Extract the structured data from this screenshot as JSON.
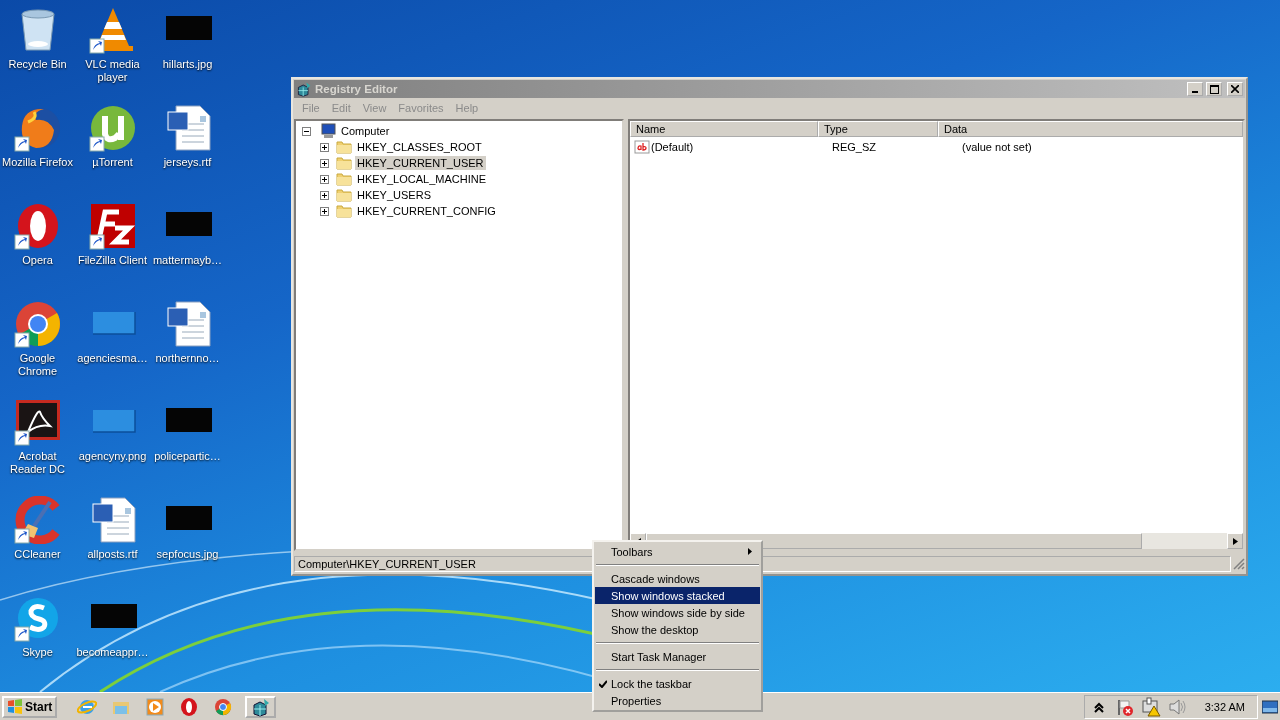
{
  "desktop": {
    "icons": [
      {
        "label": "Recycle Bin",
        "kind": "recycle",
        "shortcut": false
      },
      {
        "label": "Mozilla Firefox",
        "kind": "firefox",
        "shortcut": true
      },
      {
        "label": "Opera",
        "kind": "opera",
        "shortcut": true
      },
      {
        "label": "Google Chrome",
        "kind": "chrome",
        "shortcut": true
      },
      {
        "label": "Acrobat Reader DC",
        "kind": "acrobat",
        "shortcut": true
      },
      {
        "label": "CCleaner",
        "kind": "ccleaner",
        "shortcut": true
      },
      {
        "label": "Skype",
        "kind": "skype",
        "shortcut": true
      },
      {
        "label": "VLC media player",
        "kind": "vlc",
        "shortcut": true
      },
      {
        "label": "µTorrent",
        "kind": "utorrent",
        "shortcut": true
      },
      {
        "label": "FileZilla Client",
        "kind": "filezilla",
        "shortcut": true
      },
      {
        "label": "agenciesma…",
        "kind": "blank",
        "shortcut": false
      },
      {
        "label": "agencyny.png",
        "kind": "blank",
        "shortcut": false
      },
      {
        "label": "allposts.rtf",
        "kind": "document",
        "shortcut": false
      },
      {
        "label": "becomeappr…",
        "kind": "thumb",
        "shortcut": false
      },
      {
        "label": "hillarts.jpg",
        "kind": "thumb",
        "shortcut": false
      },
      {
        "label": "jerseys.rtf",
        "kind": "document",
        "shortcut": false
      },
      {
        "label": "mattermayb…",
        "kind": "thumb",
        "shortcut": false
      },
      {
        "label": "northernno…",
        "kind": "document",
        "shortcut": false
      },
      {
        "label": "policepartic…",
        "kind": "thumb",
        "shortcut": false
      },
      {
        "label": "sepfocus.jpg",
        "kind": "thumb",
        "shortcut": false
      }
    ]
  },
  "window": {
    "title": "Registry Editor",
    "menu": [
      "File",
      "Edit",
      "View",
      "Favorites",
      "Help"
    ],
    "tree": {
      "label": "Computer",
      "expanded": true,
      "children": [
        {
          "label": "HKEY_CLASSES_ROOT",
          "expanded": false,
          "selected": false
        },
        {
          "label": "HKEY_CURRENT_USER",
          "expanded": false,
          "selected": true
        },
        {
          "label": "HKEY_LOCAL_MACHINE",
          "expanded": false,
          "selected": false
        },
        {
          "label": "HKEY_USERS",
          "expanded": false,
          "selected": false
        },
        {
          "label": "HKEY_CURRENT_CONFIG",
          "expanded": false,
          "selected": false
        }
      ]
    },
    "values": {
      "columns": [
        "Name",
        "Type",
        "Data"
      ],
      "rows": [
        {
          "name": "(Default)",
          "type": "REG_SZ",
          "data": "(value not set)"
        }
      ]
    },
    "status_bar": "Computer\\HKEY_CURRENT_USER"
  },
  "context_menu": {
    "items": [
      {
        "kind": "submenu",
        "label": "Toolbars",
        "selected": false,
        "checked": false
      },
      {
        "kind": "separator"
      },
      {
        "kind": "item",
        "label": "Cascade windows",
        "selected": false,
        "checked": false
      },
      {
        "kind": "item",
        "label": "Show windows stacked",
        "selected": true,
        "checked": false
      },
      {
        "kind": "item",
        "label": "Show windows side by side",
        "selected": false,
        "checked": false
      },
      {
        "kind": "item",
        "label": "Show the desktop",
        "selected": false,
        "checked": false
      },
      {
        "kind": "separator"
      },
      {
        "kind": "item",
        "label": "Start Task Manager",
        "selected": false,
        "checked": false
      },
      {
        "kind": "separator"
      },
      {
        "kind": "item",
        "label": "Lock the taskbar",
        "selected": false,
        "checked": true
      },
      {
        "kind": "item",
        "label": "Properties",
        "selected": false,
        "checked": false
      }
    ]
  },
  "taskbar": {
    "start": "Start",
    "quick_launch": [
      {
        "kind": "ie"
      },
      {
        "kind": "explorer"
      },
      {
        "kind": "media"
      },
      {
        "kind": "opera"
      },
      {
        "kind": "chrome"
      }
    ],
    "tasks": [
      {
        "kind": "regedit",
        "selected": false
      }
    ],
    "tray": [
      {
        "kind": "chevron"
      },
      {
        "kind": "flag"
      },
      {
        "kind": "network"
      },
      {
        "kind": "speaker"
      }
    ],
    "clock": "3:32 AM"
  }
}
